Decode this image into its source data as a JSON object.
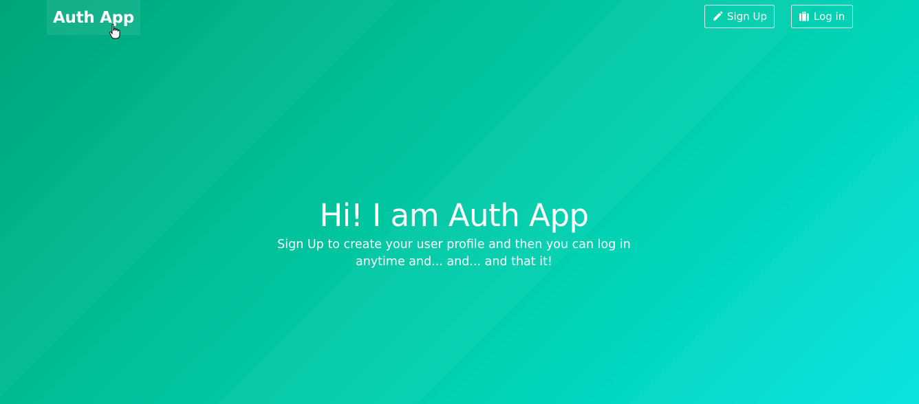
{
  "brand": {
    "label": "Auth App"
  },
  "nav": {
    "signup": {
      "label": "Sign Up",
      "icon": "pencil-icon"
    },
    "login": {
      "label": "Log in",
      "icon": "briefcase-icon"
    }
  },
  "hero": {
    "title": "Hi! I am Auth App",
    "subtitle": "Sign Up to create your user profile and then you can log in anytime and... and... and that it!"
  },
  "colors": {
    "gradient_start": "#00a57a",
    "gradient_end": "#00e2df",
    "text": "#ffffff"
  }
}
